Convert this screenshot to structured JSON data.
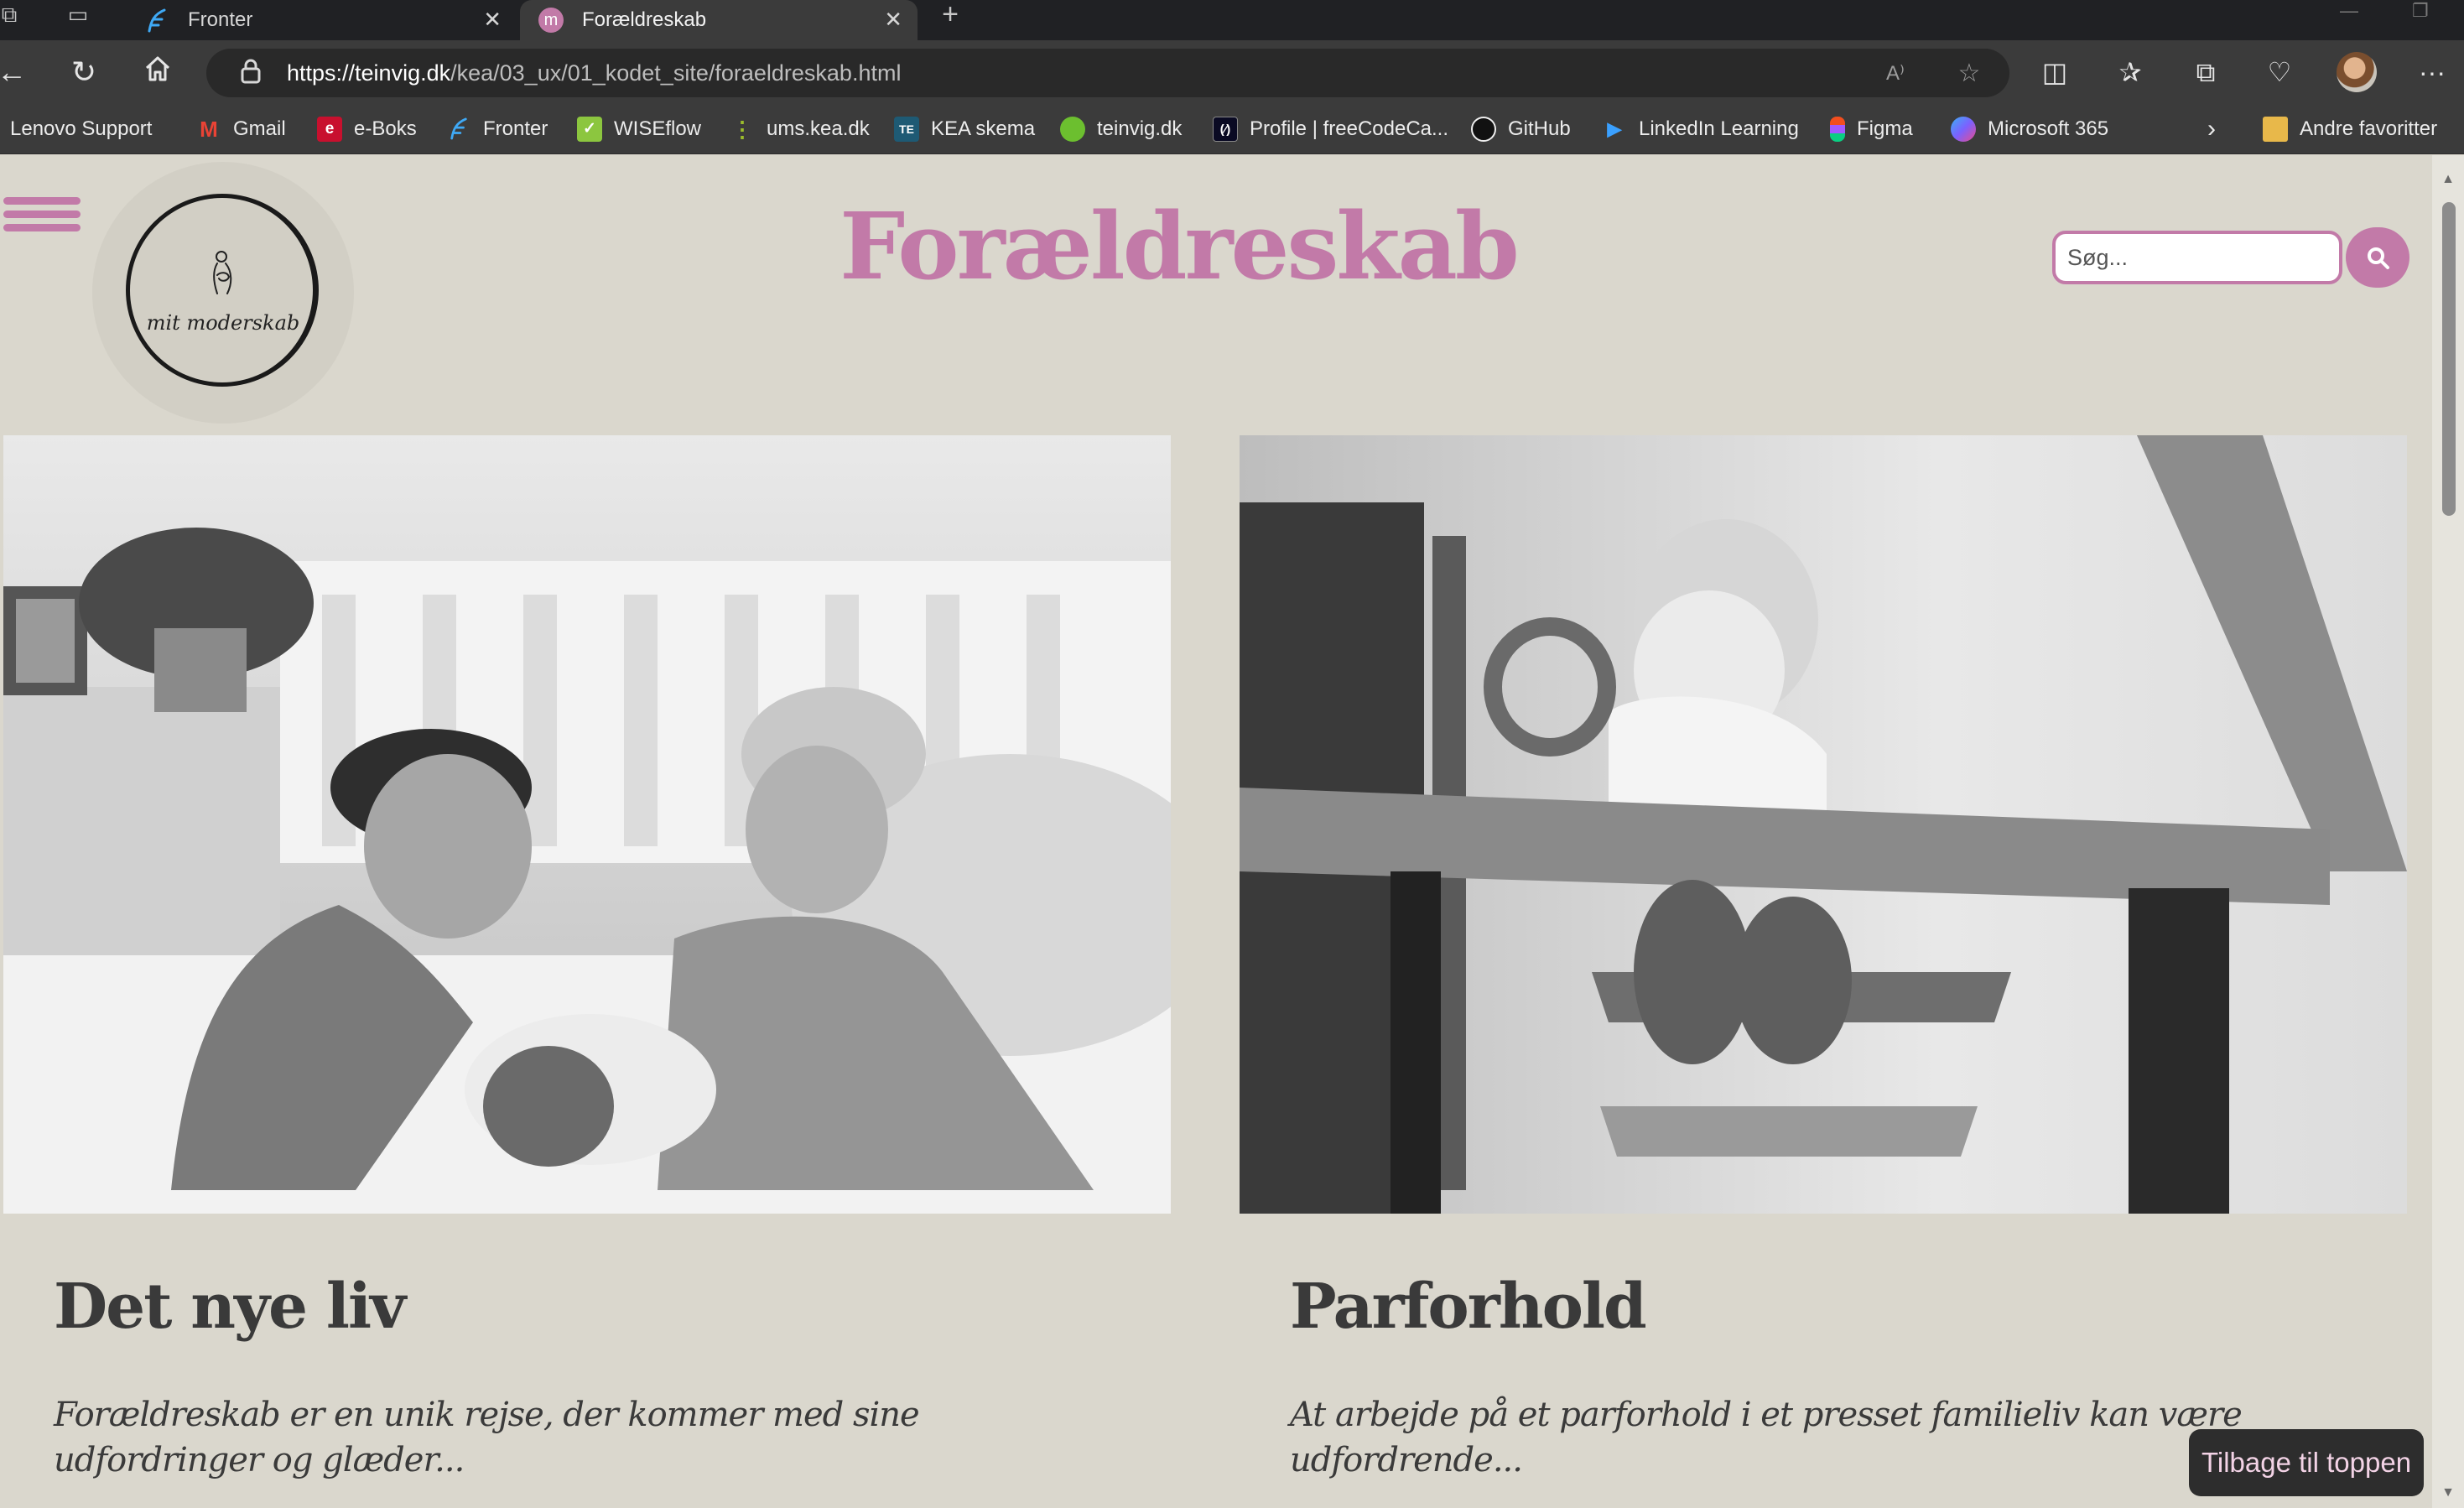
{
  "browser": {
    "tabs": [
      {
        "title": "Fronter",
        "active": false,
        "icon": "fronter-icon"
      },
      {
        "title": "Forældreskab",
        "active": true,
        "icon": "m-favicon",
        "favicon_letter": "m"
      }
    ],
    "url_domain": "https://teinvig.dk",
    "url_path": "/kea/03_ux/01_kodet_site/foraeldreskab.html",
    "bookmarks": [
      {
        "label": "Lenovo Support",
        "icon": "lenovo-icon",
        "color": "#e2231a"
      },
      {
        "label": "Gmail",
        "icon": "gmail-icon",
        "color": "#ea4335"
      },
      {
        "label": "e-Boks",
        "icon": "eboks-icon",
        "color": "#c8102e",
        "glyph": "e"
      },
      {
        "label": "Fronter",
        "icon": "fronter-icon",
        "color": "#3fa9f5"
      },
      {
        "label": "WISEflow",
        "icon": "wiseflow-icon",
        "color": "#8cc63f"
      },
      {
        "label": "ums.kea.dk",
        "icon": "ums-icon",
        "color": "#9bbd2c"
      },
      {
        "label": "KEA skema",
        "icon": "kea-skema-icon",
        "color": "#1e5a74",
        "glyph": "TE"
      },
      {
        "label": "teinvig.dk",
        "icon": "teinvig-icon",
        "color": "#6cbf2f"
      },
      {
        "label": "Profile | freeCodeCa...",
        "icon": "freecodecamp-icon",
        "color": "#0a0a23"
      },
      {
        "label": "GitHub",
        "icon": "github-icon",
        "color": "#ffffff"
      },
      {
        "label": "LinkedIn Learning",
        "icon": "linkedin-learning-icon",
        "color": "#0a66c2"
      },
      {
        "label": "Figma",
        "icon": "figma-icon",
        "color": "#f24e1e"
      },
      {
        "label": "Microsoft 365",
        "icon": "microsoft365-icon",
        "color": "#7b61ff"
      }
    ],
    "other_favorites": "Andre favoritter"
  },
  "page": {
    "logo_text": "mit moderskab",
    "title": "Forældreskab",
    "search_placeholder": "Søg...",
    "accent": "#c27aa8",
    "background": "#dad7cd",
    "back_to_top": "Tilbage til toppen",
    "cards": [
      {
        "title": "Det nye liv",
        "text": "Forældreskab er en unik rejse, der kommer med sine udfordringer og glæder..."
      },
      {
        "title": "Parforhold",
        "text": "At arbejde på et parforhold i et presset familieliv kan være udfordrende..."
      }
    ]
  }
}
